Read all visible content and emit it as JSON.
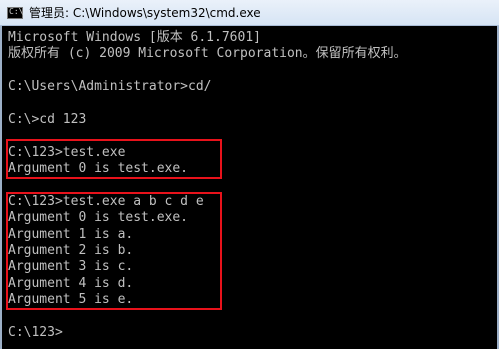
{
  "window": {
    "title": "管理员: C:\\Windows\\system32\\cmd.exe",
    "icon": "cmd-icon",
    "icon_glyph": "C:\\"
  },
  "console": {
    "lines": [
      "Microsoft Windows [版本 6.1.7601]",
      "版权所有 (c) 2009 Microsoft Corporation。保留所有权利。",
      "",
      "C:\\Users\\Administrator>cd/",
      "",
      "C:\\>cd 123",
      "",
      "C:\\123>test.exe",
      "Argument 0 is test.exe.",
      "",
      "C:\\123>test.exe a b c d e",
      "Argument 0 is test.exe.",
      "Argument 1 is a.",
      "Argument 2 is b.",
      "Argument 3 is c.",
      "Argument 4 is d.",
      "Argument 5 is e.",
      "",
      "C:\\123>"
    ]
  },
  "colors": {
    "console_bg": "#000000",
    "console_text": "#c0c0c0",
    "highlight": "#e8121b"
  }
}
